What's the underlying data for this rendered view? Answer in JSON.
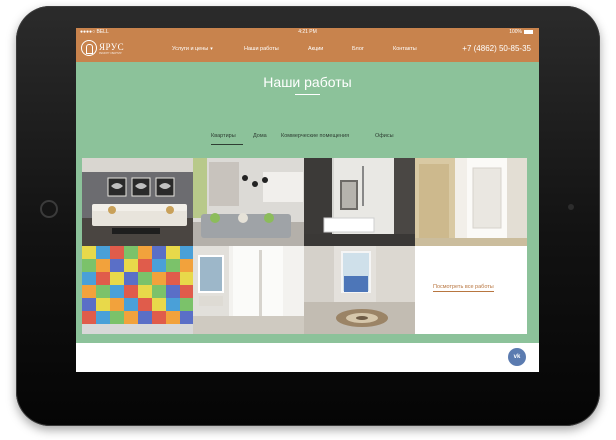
{
  "statusbar": {
    "carrier": "●●●●○ BELL",
    "time": "4:21 PM",
    "battery": "100%"
  },
  "header": {
    "logo_name": "ЯРУС",
    "logo_tag": "РЕМОНТ КВАРТИР",
    "nav": [
      "Услуги и цены",
      "Наши работы",
      "Акции",
      "Блог",
      "Контакты"
    ],
    "phone": "+7 (4862) 50-85-35"
  },
  "works": {
    "title": "Наши работы",
    "tabs": [
      "Квартиры",
      "Дома",
      "Коммерческие помещения",
      "Офисы"
    ],
    "active_tab": "Квартиры",
    "view_all": "Посмотреть все работы"
  },
  "vk_icon": "vk",
  "colors": {
    "header": "#c8834d",
    "section": "#8cc29a",
    "accent": "#b87640",
    "vk": "#5b7bb0"
  }
}
